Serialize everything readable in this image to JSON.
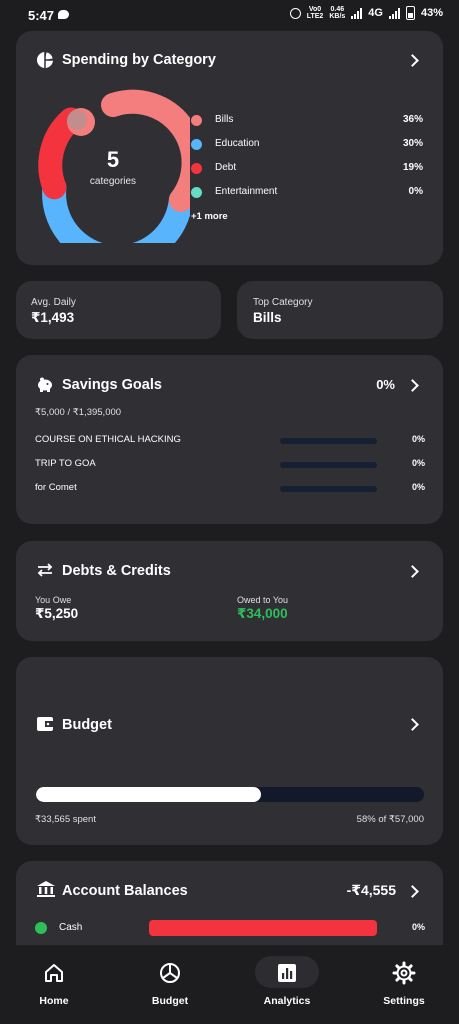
{
  "status_bar": {
    "time": "5:47",
    "net_top": "Vo0",
    "net_bottom": "LTE2",
    "speed_top": "0.46",
    "speed_bottom": "KB/s",
    "network": "4G",
    "battery": "43%"
  },
  "spending": {
    "title": "Spending by Category",
    "center_number": "5",
    "center_label": "categories",
    "legend": [
      {
        "name": "Bills",
        "pct": "36%",
        "color": "#f47d7e"
      },
      {
        "name": "Education",
        "pct": "30%",
        "color": "#58b4fd"
      },
      {
        "name": "Debt",
        "pct": "19%",
        "color": "#f3343e"
      },
      {
        "name": "Entertainment",
        "pct": "0%",
        "color": "#66dcc4"
      }
    ],
    "more": "+1 more"
  },
  "stats": {
    "avg_daily_label": "Avg. Daily",
    "avg_daily_value": "₹1,493",
    "top_category_label": "Top Category",
    "top_category_value": "Bills"
  },
  "savings": {
    "title": "Savings Goals",
    "percent": "0%",
    "summary": "₹5,000 / ₹1,395,000",
    "goals": [
      {
        "name": "COURSE ON ETHICAL HACKING",
        "pct": "0%"
      },
      {
        "name": "TRIP TO GOA",
        "pct": "0%"
      },
      {
        "name": "for Comet",
        "pct": "0%"
      }
    ]
  },
  "debts": {
    "title": "Debts & Credits",
    "you_owe_label": "You Owe",
    "you_owe_value": "₹5,250",
    "owed_label": "Owed to You",
    "owed_value": "₹34,000",
    "owed_color": "#2fbf5a"
  },
  "budget": {
    "title": "Budget",
    "spent": "₹33,565 spent",
    "progress_text": "58% of ₹57,000",
    "progress": 0.58
  },
  "accounts": {
    "title": "Account Balances",
    "total": "-₹4,555",
    "items": [
      {
        "name": "Cash",
        "pct": "0%",
        "dot_color": "#2fbf5a",
        "bar_color": "#f3343e"
      }
    ]
  },
  "nav": [
    {
      "label": "Home",
      "icon": "home-icon"
    },
    {
      "label": "Budget",
      "icon": "pie-chart-icon"
    },
    {
      "label": "Analytics",
      "icon": "bar-chart-icon",
      "active": true
    },
    {
      "label": "Settings",
      "icon": "gear-icon"
    }
  ]
}
